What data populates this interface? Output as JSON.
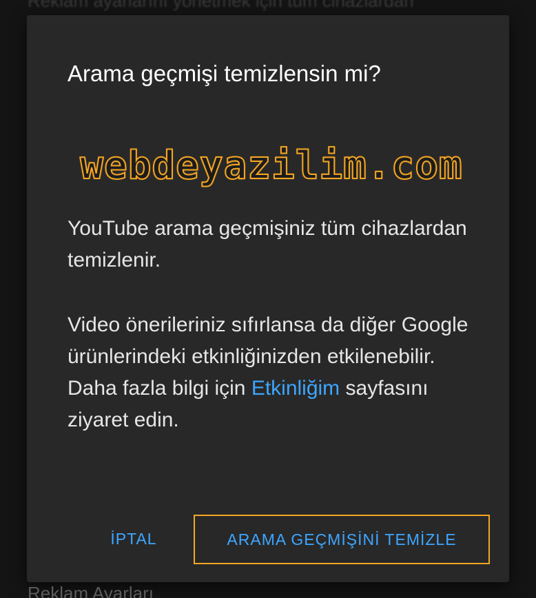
{
  "background": {
    "top_text": "Reklam ayarlarını yönetmek için tüm cihazlardan",
    "bottom_text": "Reklam Ayarları"
  },
  "dialog": {
    "title": "Arama geçmişi temizlensin mi?",
    "watermark": "webdeyazilim.com",
    "paragraph1": "YouTube arama geçmişiniz tüm cihazlardan temizlenir.",
    "paragraph2_before_link": "Video önerileriniz sıfırlansa da diğer Google ürünlerindeki etkinliğinizden etkilenebilir. Daha fazla bilgi için ",
    "link_label": "Etkinliğim",
    "paragraph2_after_link": " sayfasını ziyaret edin.",
    "cancel_label": "İPTAL",
    "clear_label": "ARAMA GEÇMİŞİNİ TEMİZLE"
  },
  "colors": {
    "accent": "#3ea6ff",
    "highlight": "#f5a623",
    "dialog_bg": "#282828"
  }
}
